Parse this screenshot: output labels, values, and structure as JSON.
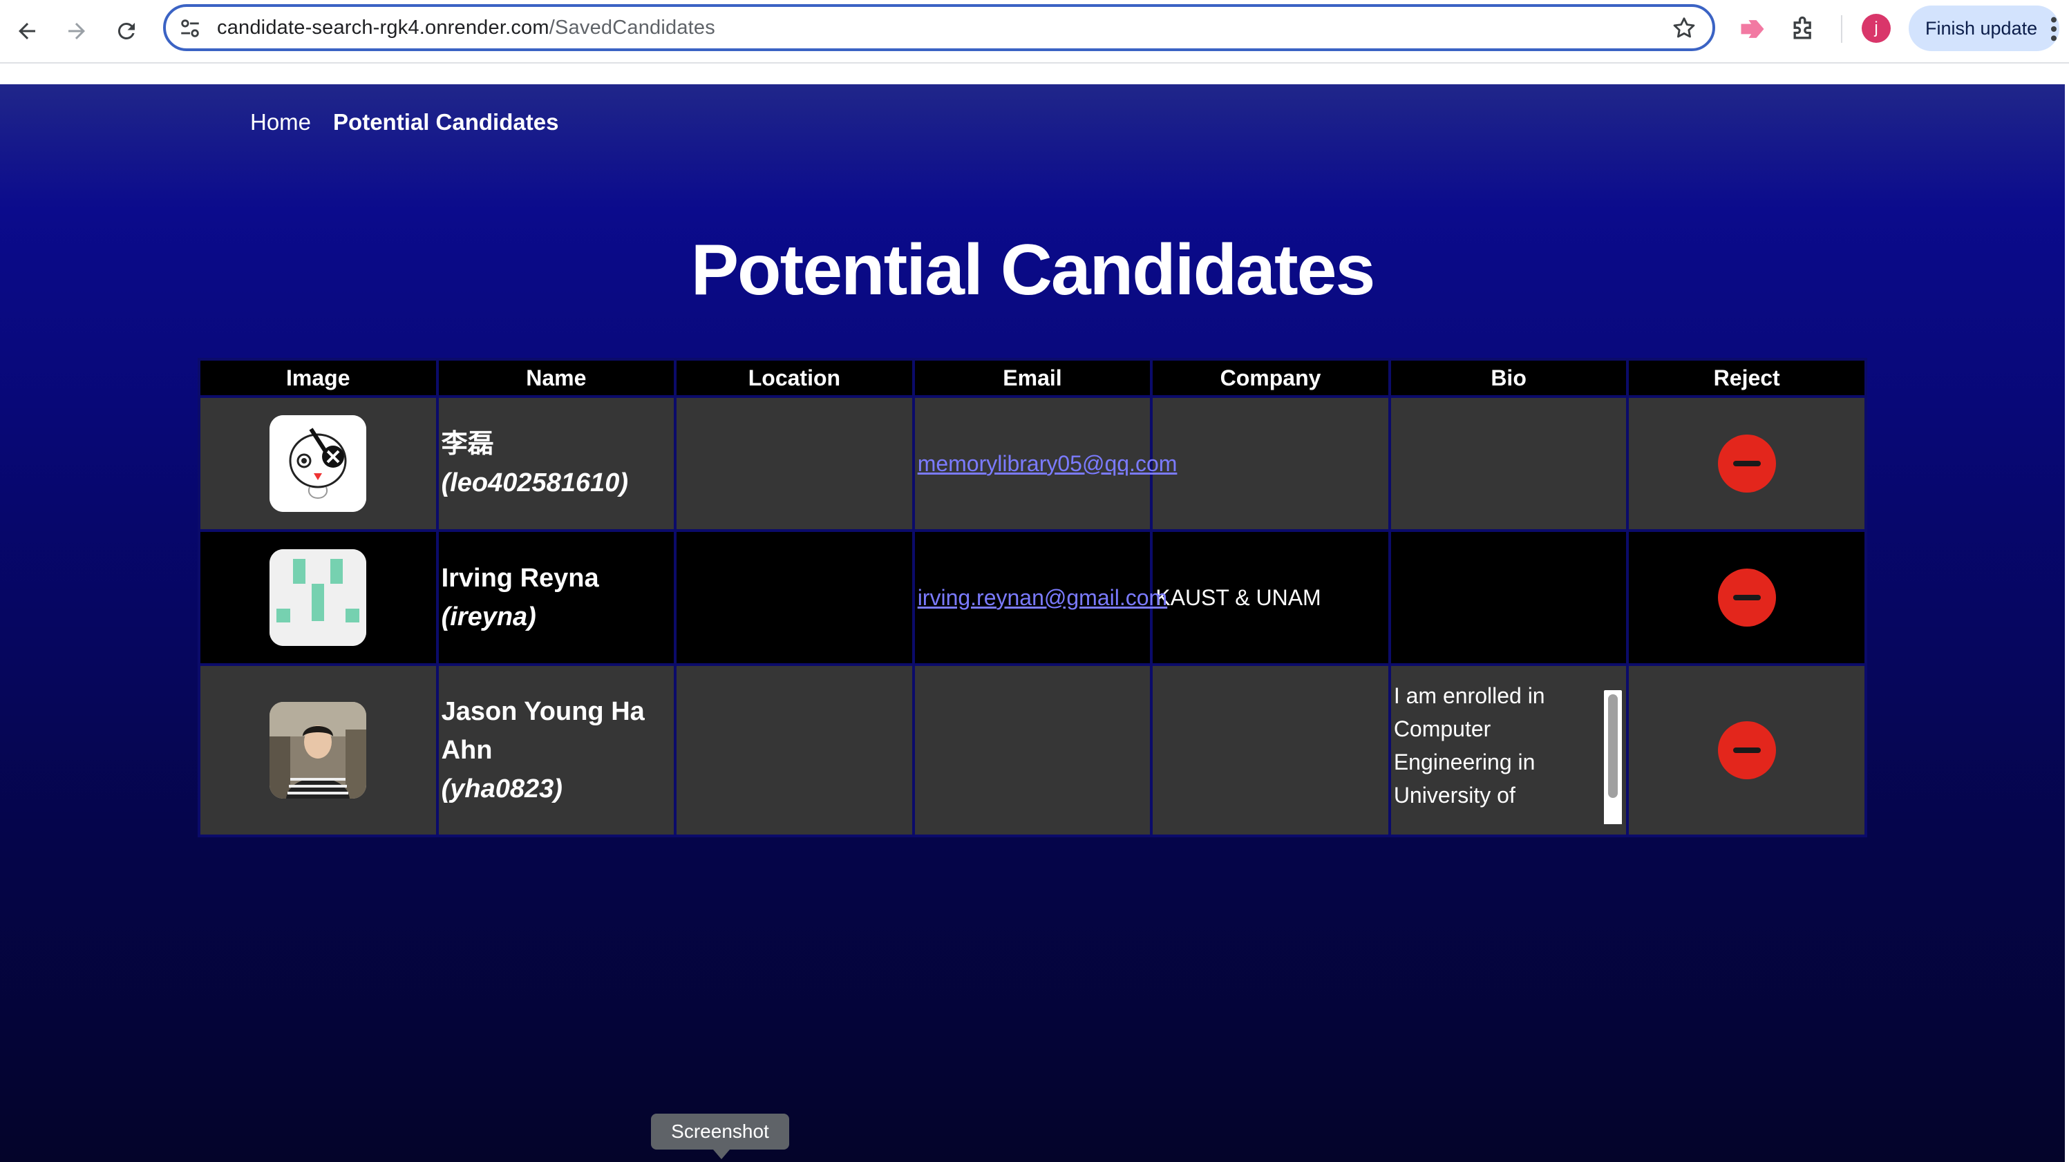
{
  "browser": {
    "url_host": "candidate-search-rgk4.onrender.com",
    "url_path": "/SavedCandidates",
    "profile_initial": "j",
    "finish_update_label": "Finish update",
    "icons": [
      "back-icon",
      "forward-icon",
      "reload-icon",
      "site-settings-icon",
      "star-icon",
      "extension-icon",
      "puzzle-icon",
      "kebab-menu-icon"
    ]
  },
  "nav": {
    "home": "Home",
    "potential": "Potential Candidates"
  },
  "page": {
    "title": "Potential Candidates"
  },
  "table": {
    "headers": [
      "Image",
      "Name",
      "Location",
      "Email",
      "Company",
      "Bio",
      "Reject"
    ],
    "rows": [
      {
        "name": "李磊",
        "login": "(leo402581610)",
        "location": "",
        "email": "memorylibrary05@qq.com",
        "company": "",
        "bio": ""
      },
      {
        "name": "Irving Reyna",
        "login": "(ireyna)",
        "location": "",
        "email": "irving.reynan@gmail.com",
        "company": "KAUST & UNAM",
        "bio": ""
      },
      {
        "name": "Jason Young Ha Ahn",
        "login": "(yha0823)",
        "location": "",
        "email": "",
        "company": "",
        "bio": "I am enrolled in Computer Engineering in University of"
      }
    ]
  },
  "tooltip": {
    "text": "Screenshot"
  },
  "colors": {
    "accent_link": "#7b7bff",
    "reject": "#e3261c",
    "row_gray": "#363636",
    "header_bg": "#000000"
  }
}
